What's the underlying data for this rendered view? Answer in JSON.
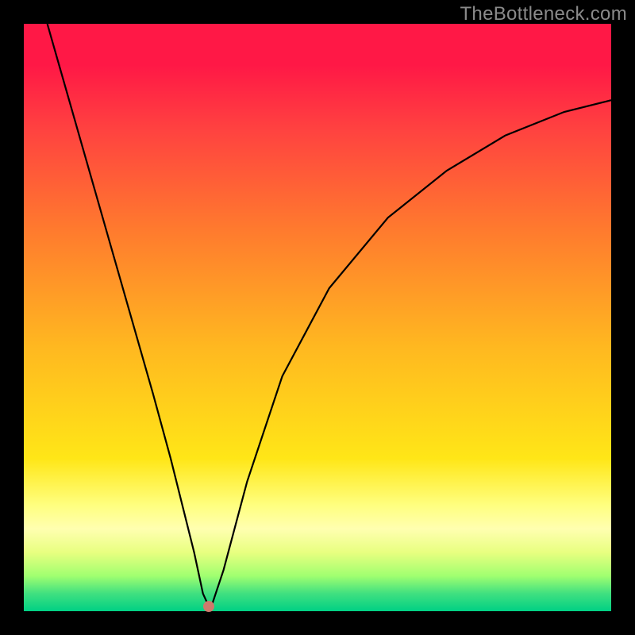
{
  "meta": {
    "watermark": "TheBottleneck.com"
  },
  "chart_data": {
    "type": "line",
    "title": "",
    "xlabel": "",
    "ylabel": "",
    "xlim": [
      0,
      100
    ],
    "ylim": [
      0,
      100
    ],
    "grid": false,
    "curve": {
      "name": "bottleneck",
      "x": [
        4,
        6,
        10,
        14,
        18,
        22,
        25,
        27,
        29,
        30.5,
        31.5,
        32,
        34,
        38,
        44,
        52,
        62,
        72,
        82,
        92,
        100
      ],
      "values": [
        100,
        93,
        79,
        65,
        51,
        37,
        26,
        18,
        10,
        3,
        0.8,
        1,
        7,
        22,
        40,
        55,
        67,
        75,
        81,
        85,
        87
      ]
    },
    "marker": {
      "x": 31.5,
      "y": 0.8,
      "color": "#CE7A6C"
    },
    "gradient_stops": [
      {
        "pct": 0,
        "color": "#FF1846"
      },
      {
        "pct": 7,
        "color": "#FF1846"
      },
      {
        "pct": 18,
        "color": "#FF4240"
      },
      {
        "pct": 35,
        "color": "#FF7A2E"
      },
      {
        "pct": 55,
        "color": "#FFB820"
      },
      {
        "pct": 74,
        "color": "#FFE617"
      },
      {
        "pct": 82,
        "color": "#FFFF80"
      },
      {
        "pct": 86,
        "color": "#FFFFB0"
      },
      {
        "pct": 90,
        "color": "#E8FF80"
      },
      {
        "pct": 94,
        "color": "#A0FF70"
      },
      {
        "pct": 97,
        "color": "#40E080"
      },
      {
        "pct": 100,
        "color": "#00D084"
      }
    ]
  }
}
